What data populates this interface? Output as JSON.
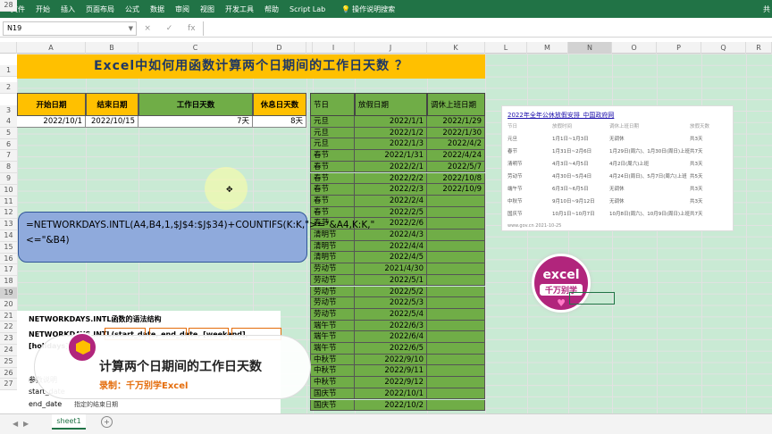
{
  "ribbon": [
    "文件",
    "开始",
    "插入",
    "页面布局",
    "公式",
    "数据",
    "审阅",
    "视图",
    "开发工具",
    "帮助",
    "Script Lab"
  ],
  "ribbon_search": "操作说明搜索",
  "ribbon_right": "共",
  "name_box": "N19",
  "formula_btns": [
    "×",
    "✓",
    "fx"
  ],
  "columns": [
    "A",
    "B",
    "C",
    "D",
    "I",
    "J",
    "K",
    "L",
    "M",
    "N",
    "O",
    "P",
    "Q",
    "R"
  ],
  "rows": [
    "1",
    "2",
    "3",
    "4",
    "5",
    "6",
    "7",
    "8",
    "9",
    "10",
    "11",
    "12",
    "13",
    "14",
    "15",
    "16",
    "17",
    "18",
    "19",
    "20",
    "21",
    "22",
    "23",
    "24",
    "25",
    "26",
    "27",
    "28"
  ],
  "title": "Excel中如何用函数计算两个日期间的工作日天数 ？",
  "main_headers": [
    "开始日期",
    "结束日期",
    "工作日天数",
    "休息日天数"
  ],
  "main_values": [
    "2022/10/1",
    "2022/10/15",
    "7天",
    "8天"
  ],
  "holiday_headers": [
    "节日",
    "放假日期",
    "调休上班日期"
  ],
  "holidays": [
    [
      "元旦",
      "2022/1/1",
      "2022/1/29"
    ],
    [
      "元旦",
      "2022/1/2",
      "2022/1/30"
    ],
    [
      "元旦",
      "2022/1/3",
      "2022/4/2"
    ],
    [
      "春节",
      "2022/1/31",
      "2022/4/24"
    ],
    [
      "春节",
      "2022/2/1",
      "2022/5/7"
    ],
    [
      "春节",
      "2022/2/2",
      "2022/10/8"
    ],
    [
      "春节",
      "2022/2/3",
      "2022/10/9"
    ],
    [
      "春节",
      "2022/2/4",
      ""
    ],
    [
      "春节",
      "2022/2/5",
      ""
    ],
    [
      "春节",
      "2022/2/6",
      ""
    ],
    [
      "清明节",
      "2022/4/3",
      ""
    ],
    [
      "清明节",
      "2022/4/4",
      ""
    ],
    [
      "清明节",
      "2022/4/5",
      ""
    ],
    [
      "劳动节",
      "2021/4/30",
      ""
    ],
    [
      "劳动节",
      "2022/5/1",
      ""
    ],
    [
      "劳动节",
      "2022/5/2",
      ""
    ],
    [
      "劳动节",
      "2022/5/3",
      ""
    ],
    [
      "劳动节",
      "2022/5/4",
      ""
    ],
    [
      "端午节",
      "2022/6/3",
      ""
    ],
    [
      "端午节",
      "2022/6/4",
      ""
    ],
    [
      "端午节",
      "2022/6/5",
      ""
    ],
    [
      "中秋节",
      "2022/9/10",
      ""
    ],
    [
      "中秋节",
      "2022/9/11",
      ""
    ],
    [
      "中秋节",
      "2022/9/12",
      ""
    ],
    [
      "国庆节",
      "2022/10/1",
      ""
    ],
    [
      "国庆节",
      "2022/10/2",
      ""
    ]
  ],
  "formula_text": "=NETWORKDAYS.INTL(A4,B4,1,$J$4:$J$34)+COUNTIFS(K:K,\">=\"&A4,K:K,\"<=\"&B4)",
  "syntax": {
    "title": "NETWORKDAYS.INTL函数的语法结构",
    "line": "NETWORKDAYS.INTL(start_date, end_date, [weekend], [holidays])",
    "params": "参数说明",
    "p1": "start_date",
    "p2": "end_date",
    "p2desc": "指定的结束日期"
  },
  "overlay": {
    "title": "计算两个日期间的工作日天数",
    "sub": "录制：千万别学Excel"
  },
  "logo": {
    "line1": "excel",
    "line2": "千万别学"
  },
  "notice": {
    "title": "2022年全年公休放假安排_中国政府网",
    "cols": [
      "节日",
      "放假时间",
      "调休上班日期",
      "放假天数"
    ],
    "rows": [
      [
        "元旦",
        "1月1日~1月3日",
        "无调休",
        "共3天"
      ],
      [
        "春节",
        "1月31日~2月6日",
        "1月29日(周六)、1月30日(周日)上班",
        "共7天"
      ],
      [
        "清明节",
        "4月3日~4月5日",
        "4月2日(周六)上班",
        "共3天"
      ],
      [
        "劳动节",
        "4月30日~5月4日",
        "4月24日(周日)、5月7日(周六)上班",
        "共5天"
      ],
      [
        "端午节",
        "6月3日~6月5日",
        "无调休",
        "共3天"
      ],
      [
        "中秋节",
        "9月10日~9月12日",
        "无调休",
        "共3天"
      ],
      [
        "国庆节",
        "10月1日~10月7日",
        "10月8日(周六)、10月9日(周日)上班",
        "共7天"
      ]
    ],
    "footer": "www.gov.cn 2021-10-25"
  },
  "sheet_tab": "sheet1",
  "add_sheet": "+"
}
